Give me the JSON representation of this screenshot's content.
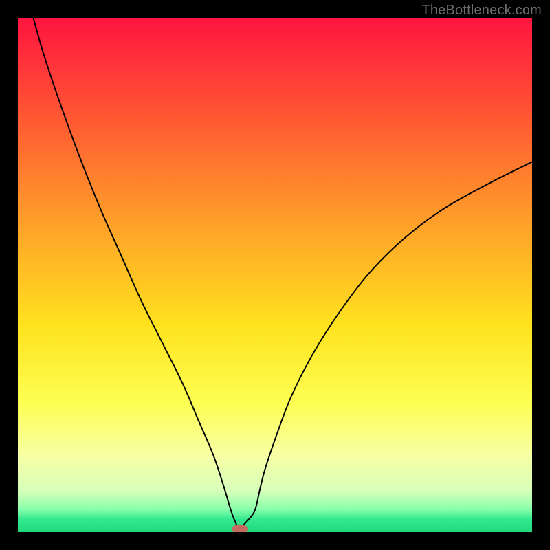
{
  "watermark": "TheBottleneck.com",
  "chart_data": {
    "type": "line",
    "title": "",
    "xlabel": "",
    "ylabel": "",
    "xlim": [
      0,
      100
    ],
    "ylim": [
      0,
      100
    ],
    "grid": false,
    "legend": false,
    "background": {
      "gradient_stops": [
        {
          "offset": 0.0,
          "color": "#ff1440"
        },
        {
          "offset": 0.2,
          "color": "#ff5a32"
        },
        {
          "offset": 0.4,
          "color": "#ffa029"
        },
        {
          "offset": 0.6,
          "color": "#ffe31e"
        },
        {
          "offset": 0.75,
          "color": "#fdff53"
        },
        {
          "offset": 0.85,
          "color": "#f7ffa4"
        },
        {
          "offset": 0.92,
          "color": "#d6ffb9"
        },
        {
          "offset": 0.955,
          "color": "#8bffac"
        },
        {
          "offset": 0.975,
          "color": "#33e98f"
        },
        {
          "offset": 1.0,
          "color": "#1ed97c"
        }
      ]
    },
    "series": [
      {
        "name": "bottleneck-curve",
        "stroke": "#000000",
        "stroke_width": 2,
        "x": [
          3,
          5,
          8,
          12,
          16,
          20,
          24,
          28,
          32,
          35,
          38,
          40,
          41.5,
          42.5,
          43,
          43.5,
          44,
          46,
          47,
          48,
          50,
          53,
          57,
          62,
          68,
          75,
          83,
          92,
          100
        ],
        "y": [
          100,
          93,
          84,
          73,
          63,
          54,
          45,
          37,
          29,
          22,
          15,
          9,
          4,
          1.5,
          0.7,
          0.7,
          1.5,
          4,
          8,
          12,
          18,
          26,
          34,
          42,
          50,
          57,
          63,
          68,
          72
        ]
      }
    ],
    "marker": {
      "name": "bottleneck-marker",
      "x": 43.2,
      "y": 0.6,
      "rx": 1.6,
      "ry": 0.9,
      "fill": "#c46a61"
    },
    "frame": {
      "outer_border_px": 26,
      "plot_border_px": 2,
      "color": "#000000"
    }
  }
}
